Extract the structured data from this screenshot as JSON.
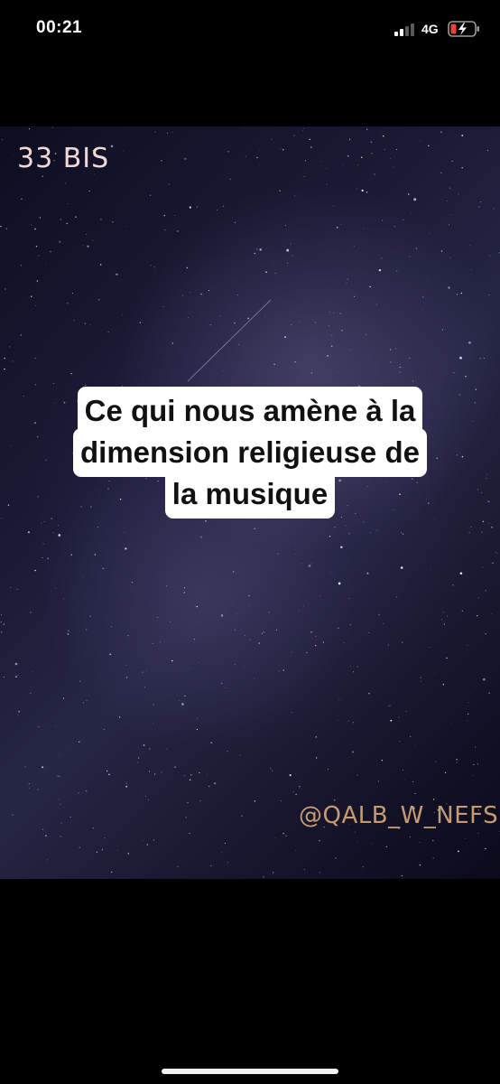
{
  "status_bar": {
    "time": "00:21",
    "network": "4G",
    "icons": [
      "signal-bars-icon",
      "battery-charging-icon"
    ],
    "battery_color": "#e5443b"
  },
  "story": {
    "corner_tag": "33 BIS",
    "caption_lines": [
      "Ce qui nous amène à la",
      "dimension religieuse de",
      "la musique"
    ],
    "handle": "@QALB_W_NEFS"
  },
  "colors": {
    "background": "#000000",
    "caption_bg": "#ffffff",
    "corner_tag_color": "#f3d9d6",
    "handle_color": "#c79a72"
  }
}
